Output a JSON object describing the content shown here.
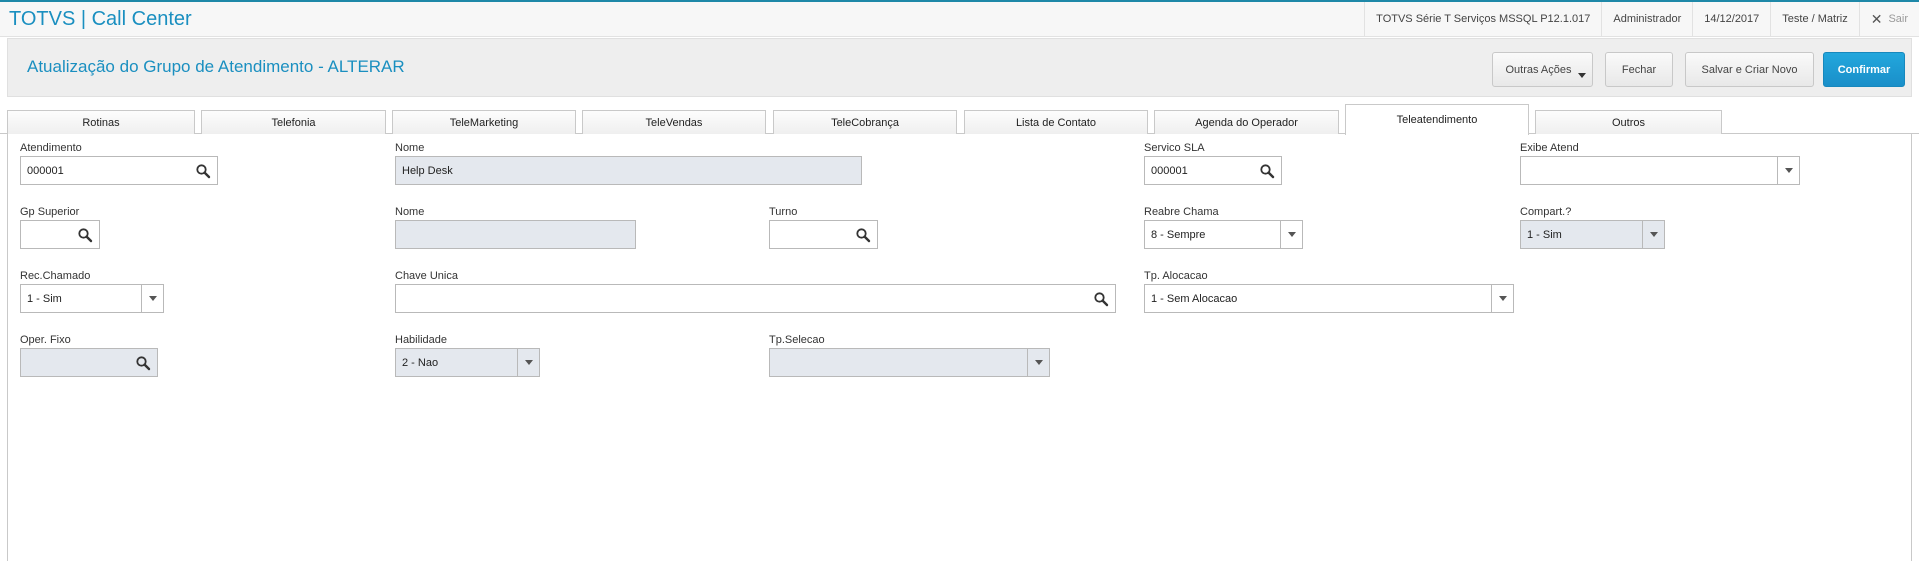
{
  "app": {
    "title": "TOTVS | Call Center",
    "environment": "TOTVS Série T Serviços MSSQL P12.1.017",
    "user": "Administrador",
    "date": "14/12/2017",
    "branch": "Teste / Matriz",
    "logout_label": "Sair"
  },
  "header": {
    "title": "Atualização do Grupo de Atendimento - ALTERAR",
    "buttons": {
      "outras_acoes": "Outras Ações",
      "fechar": "Fechar",
      "salvar_criar": "Salvar e Criar Novo",
      "confirmar": "Confirmar"
    }
  },
  "tabs": [
    {
      "label": "Rotinas"
    },
    {
      "label": "Telefonia"
    },
    {
      "label": "TeleMarketing"
    },
    {
      "label": "TeleVendas"
    },
    {
      "label": "TeleCobrança"
    },
    {
      "label": "Lista de Contato"
    },
    {
      "label": "Agenda do Operador"
    },
    {
      "label": "Teleatendimento"
    },
    {
      "label": "Outros"
    }
  ],
  "active_tab": "Teleatendimento",
  "form": {
    "atendimento": {
      "label": "Atendimento",
      "value": "000001"
    },
    "nome1": {
      "label": "Nome",
      "value": "Help Desk"
    },
    "servico_sla": {
      "label": "Servico SLA",
      "value": "000001"
    },
    "exibe_atend": {
      "label": "Exibe Atend",
      "value": ""
    },
    "gp_superior": {
      "label": "Gp Superior",
      "value": ""
    },
    "nome2": {
      "label": "Nome",
      "value": ""
    },
    "turno": {
      "label": "Turno",
      "value": ""
    },
    "reabre_chama": {
      "label": "Reabre Chama",
      "value": "8 - Sempre"
    },
    "compart": {
      "label": "Compart.?",
      "value": "1 - Sim"
    },
    "rec_chamado": {
      "label": "Rec.Chamado",
      "value": "1 - Sim"
    },
    "chave_unica": {
      "label": "Chave Unica",
      "value": ""
    },
    "tp_alocacao": {
      "label": "Tp. Alocacao",
      "value": "1 - Sem Alocacao"
    },
    "oper_fixo": {
      "label": "Oper. Fixo",
      "value": ""
    },
    "habilidade": {
      "label": "Habilidade",
      "value": "2 - Nao"
    },
    "tp_selecao": {
      "label": "Tp.Selecao",
      "value": ""
    }
  },
  "colors": {
    "accent": "#1a8fc0",
    "confirm_button": "#1a8fc9",
    "readonly_field": "#e4e8ee"
  }
}
